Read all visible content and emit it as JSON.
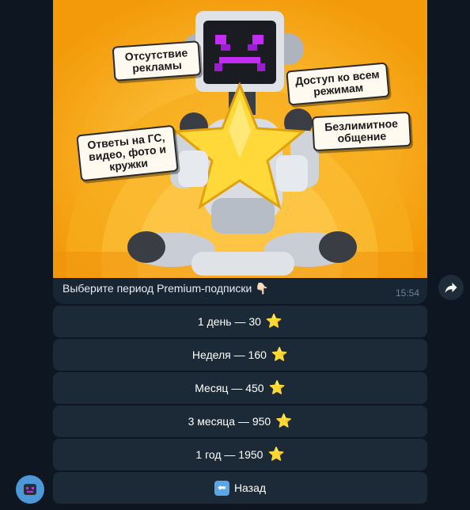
{
  "message": {
    "stickers": [
      "Отсутствие рекламы",
      "Доступ ко всем режимам",
      "Ответы на ГС, видео, фото и кружки",
      "Безлимитное общение"
    ],
    "caption": "Выберите период Premium-подписки 👇🏻",
    "time": "15:54"
  },
  "keyboard": {
    "buttons": [
      {
        "label": "1 день — 30"
      },
      {
        "label": "Неделя — 160"
      },
      {
        "label": "Месяц — 450"
      },
      {
        "label": "3 месяца — 950"
      },
      {
        "label": "1 год — 1950"
      }
    ],
    "star": "⭐",
    "back_label": "Назад",
    "back_icon": "⬅"
  },
  "colors": {
    "background": "#0e1621",
    "bubble": "#182533",
    "button": "#1c2a38",
    "accent": "#4c98d9",
    "photo_orange": "#f6a60e"
  }
}
